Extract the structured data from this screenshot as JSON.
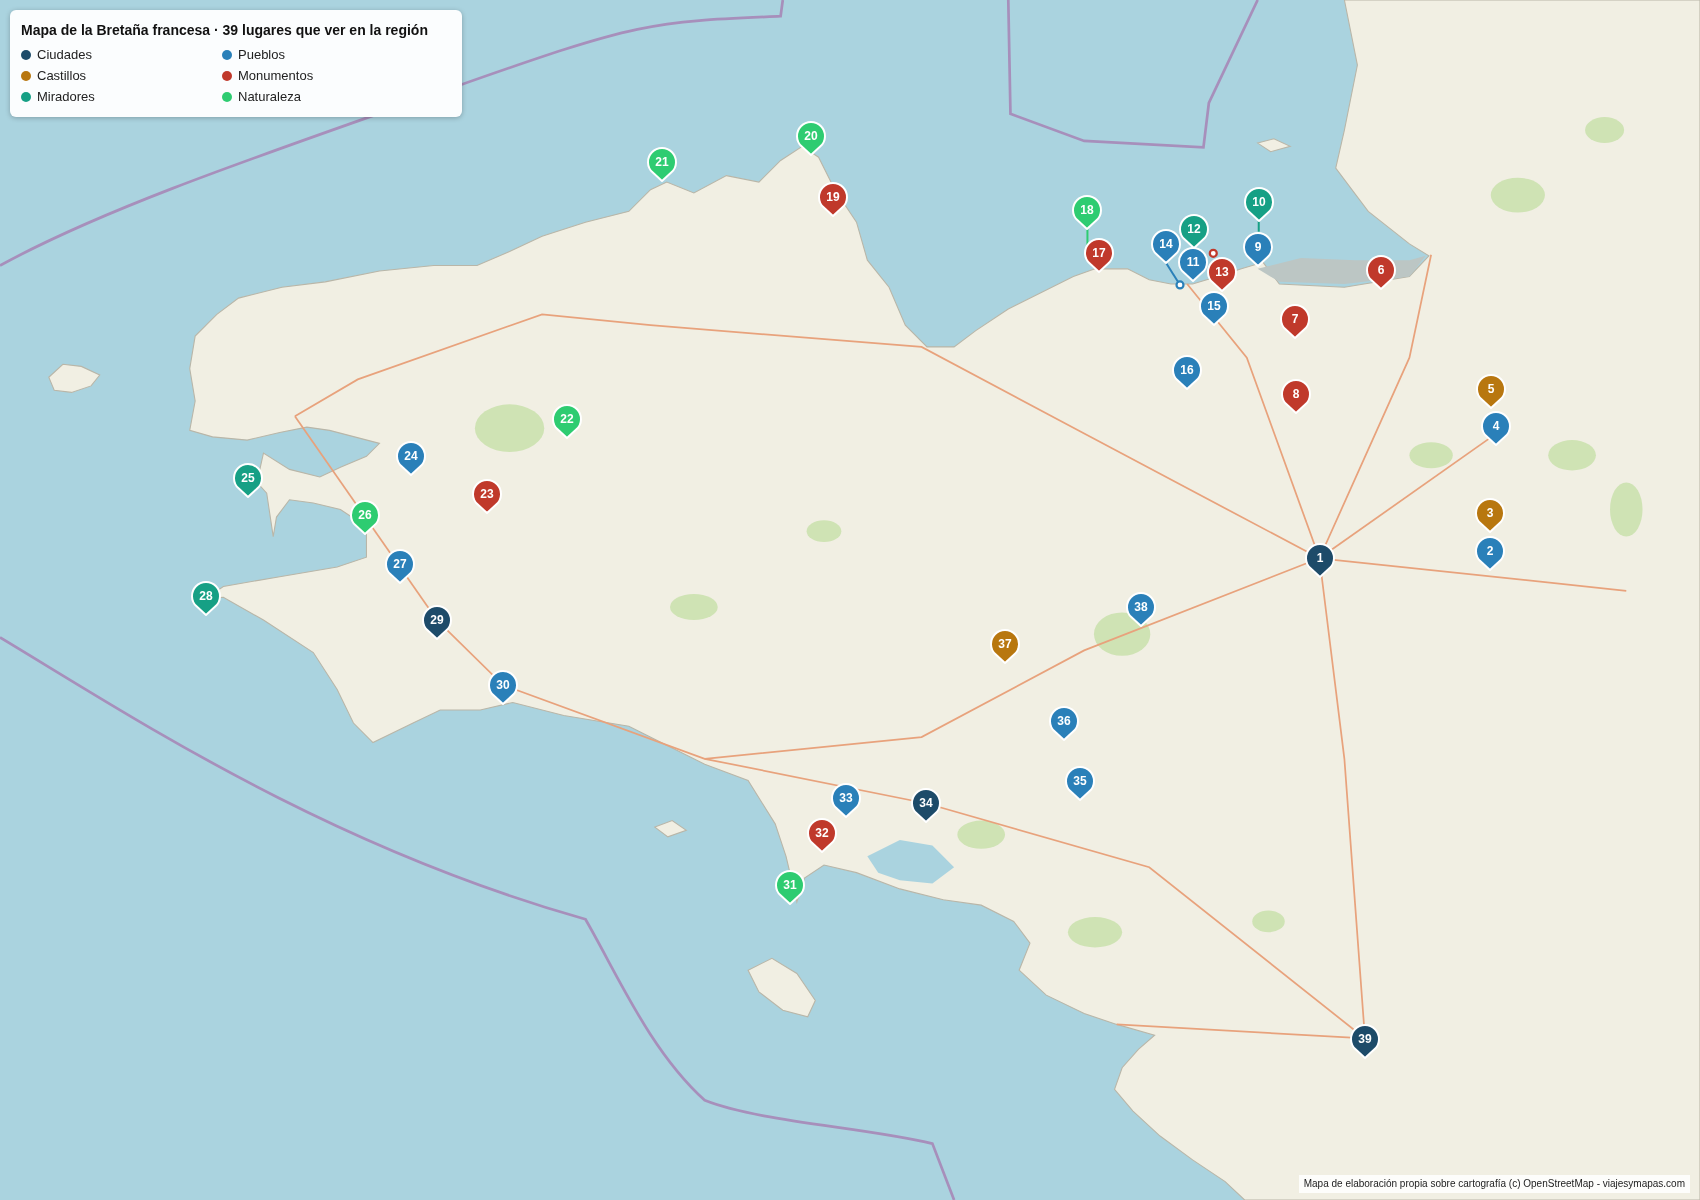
{
  "legend": {
    "title": "Mapa de la Bretaña francesa · 39 lugares que ver en la región",
    "items": [
      {
        "label": "Ciudades",
        "color": "#1d4b69"
      },
      {
        "label": "Pueblos",
        "color": "#2a80b9"
      },
      {
        "label": "Castillos",
        "color": "#b8770f"
      },
      {
        "label": "Monumentos",
        "color": "#c0392b"
      },
      {
        "label": "Miradores",
        "color": "#16a085"
      },
      {
        "label": "Naturaleza",
        "color": "#2ecc71"
      }
    ]
  },
  "markers": [
    {
      "label": "1",
      "color": "#1d4b69"
    },
    {
      "label": "3",
      "color": "#b8770f"
    },
    {
      "label": "2",
      "color": "#2a80b9"
    },
    {
      "label": "4",
      "color": "#2a80b9"
    },
    {
      "label": "5",
      "color": "#b8770f"
    },
    {
      "label": "6",
      "color": "#c0392b"
    },
    {
      "label": "7",
      "color": "#c0392b"
    },
    {
      "label": "8",
      "color": "#c0392b"
    },
    {
      "label": "9",
      "color": "#2a80b9"
    },
    {
      "label": "10",
      "color": "#16a085"
    },
    {
      "label": "12",
      "color": "#16a085"
    },
    {
      "label": "11",
      "color": "#2a80b9"
    },
    {
      "label": "13",
      "color": "#c0392b"
    },
    {
      "label": "14",
      "color": "#2a80b9"
    },
    {
      "label": "15",
      "color": "#2a80b9"
    },
    {
      "label": "16",
      "color": "#2a80b9"
    },
    {
      "label": "17",
      "color": "#c0392b"
    },
    {
      "label": "18",
      "color": "#2ecc71"
    },
    {
      "label": "19",
      "color": "#c0392b"
    },
    {
      "label": "20",
      "color": "#2ecc71"
    },
    {
      "label": "21",
      "color": "#2ecc71"
    },
    {
      "label": "22",
      "color": "#2ecc71"
    },
    {
      "label": "23",
      "color": "#c0392b"
    },
    {
      "label": "24",
      "color": "#2a80b9"
    },
    {
      "label": "25",
      "color": "#16a085"
    },
    {
      "label": "26",
      "color": "#2ecc71"
    },
    {
      "label": "27",
      "color": "#2a80b9"
    },
    {
      "label": "28",
      "color": "#16a085"
    },
    {
      "label": "29",
      "color": "#1d4b69"
    },
    {
      "label": "30",
      "color": "#2a80b9"
    },
    {
      "label": "31",
      "color": "#2ecc71"
    },
    {
      "label": "32",
      "color": "#c0392b"
    },
    {
      "label": "33",
      "color": "#2a80b9"
    },
    {
      "label": "34",
      "color": "#1d4b69"
    },
    {
      "label": "35",
      "color": "#2a80b9"
    },
    {
      "label": "36",
      "color": "#2a80b9"
    },
    {
      "label": "37",
      "color": "#b8770f"
    },
    {
      "label": "38",
      "color": "#2a80b9"
    },
    {
      "label": "39",
      "color": "#1d4b69"
    }
  ],
  "attribution": "Mapa de elaboración propia sobre cartografía (c) OpenStreetMap - viajesymapas.com"
}
